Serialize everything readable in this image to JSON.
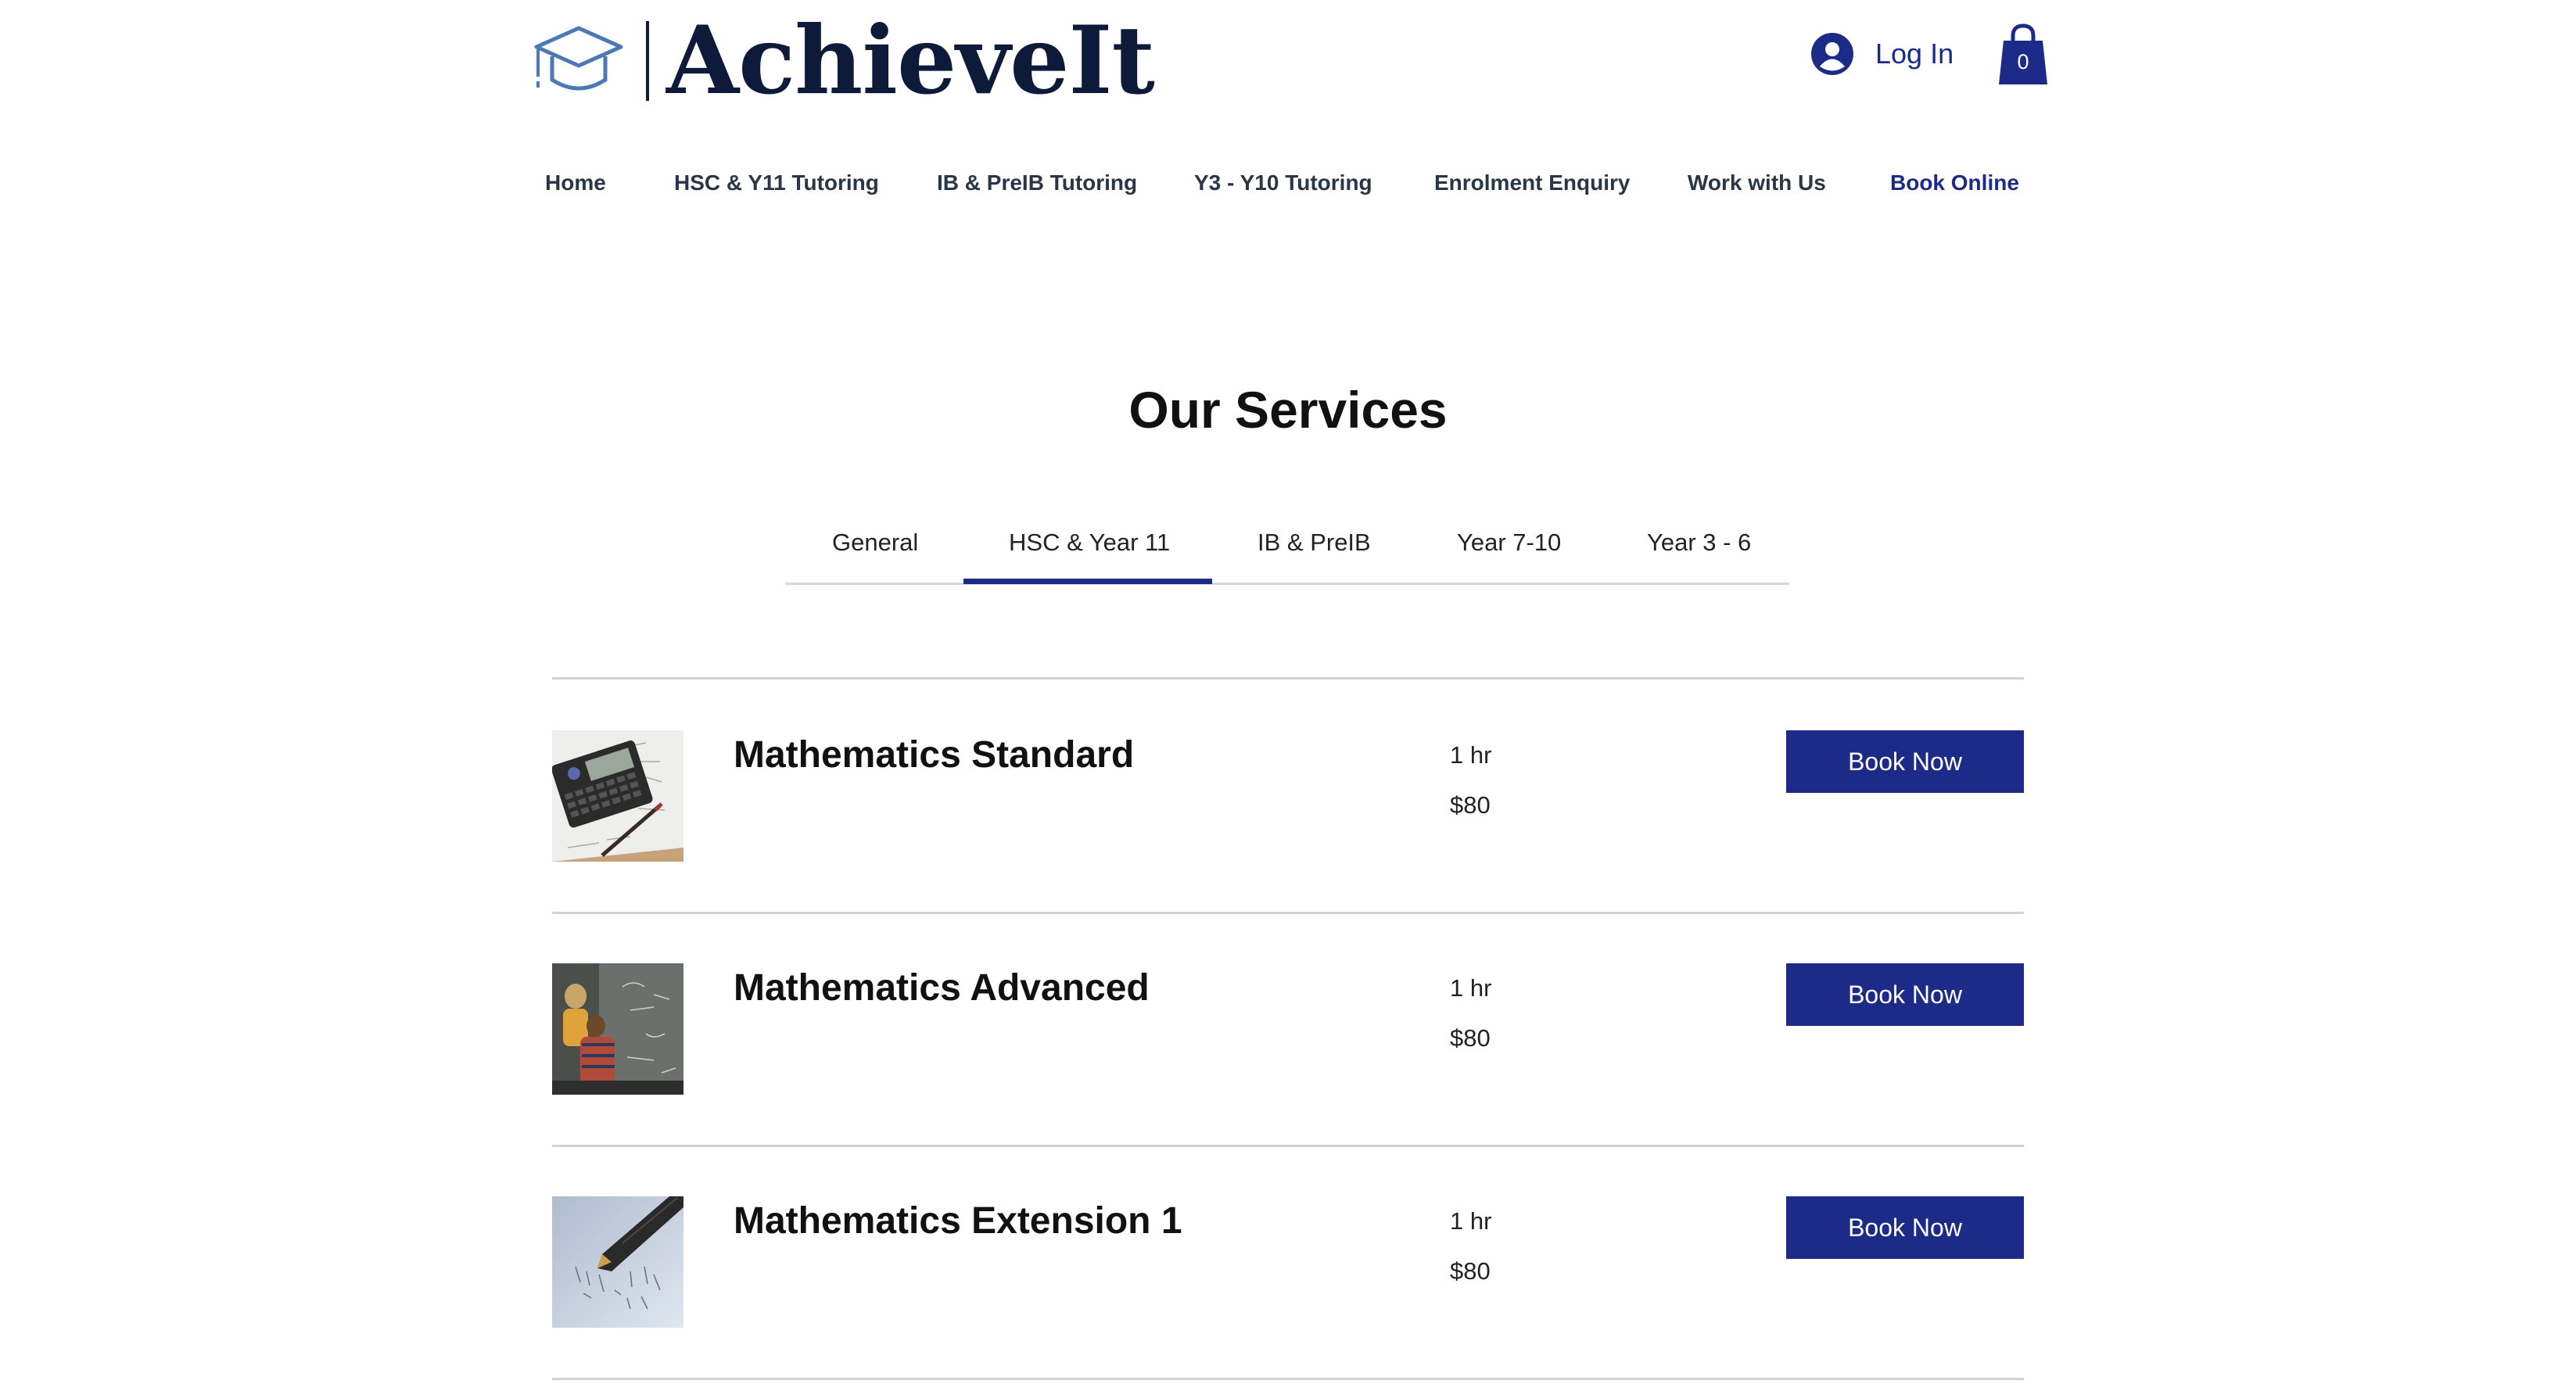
{
  "header": {
    "logo_text": "AchieveIt",
    "login_label": "Log In",
    "cart_count": "0"
  },
  "nav": {
    "items": [
      {
        "label": "Home"
      },
      {
        "label": "HSC & Y11 Tutoring"
      },
      {
        "label": "IB & PreIB Tutoring"
      },
      {
        "label": "Y3 - Y10 Tutoring"
      },
      {
        "label": "Enrolment Enquiry"
      },
      {
        "label": "Work with Us"
      },
      {
        "label": "Book Online",
        "active": true
      }
    ]
  },
  "services": {
    "title": "Our Services",
    "tabs": [
      {
        "label": "General"
      },
      {
        "label": "HSC & Year 11",
        "active": true
      },
      {
        "label": "IB & PreIB"
      },
      {
        "label": "Year 7-10"
      },
      {
        "label": "Year 3 - 6"
      }
    ],
    "items": [
      {
        "name": "Mathematics Standard",
        "duration": "1 hr",
        "price": "$80",
        "button_label": "Book Now",
        "image": "calculator-photo"
      },
      {
        "name": "Mathematics Advanced",
        "duration": "1 hr",
        "price": "$80",
        "button_label": "Book Now",
        "image": "children-at-blackboard-photo"
      },
      {
        "name": "Mathematics Extension 1",
        "duration": "1 hr",
        "price": "$80",
        "button_label": "Book Now",
        "image": "pen-on-math-paper-photo"
      }
    ]
  },
  "colors": {
    "brand_navy": "#1d2b88",
    "logo_dark": "#0e1a3a",
    "logo_cap_blue": "#4a79b5",
    "divider_gray": "#d2d2d2"
  }
}
